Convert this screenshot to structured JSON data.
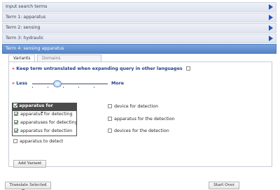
{
  "accordion": [
    {
      "label": "Input search terms",
      "active": false
    },
    {
      "label": "Term 1: apparatus",
      "active": false
    },
    {
      "label": "Term 2: sensing",
      "active": false
    },
    {
      "label": "Term 3: hydraulic",
      "active": false
    },
    {
      "label": "Term 4: sensing apparatus",
      "active": true
    }
  ],
  "tabs": {
    "variants": "Variants",
    "domains": "Domains [AUTO,DATA,HORO,MEAS]"
  },
  "keep_untranslated": {
    "label": "Keep term untranslated when expanding query in other languages",
    "checked": false
  },
  "slider": {
    "less": "Less",
    "more": "More",
    "level_fraction": 0.33
  },
  "selected_group": {
    "title": "apparatus for detecting",
    "items": [
      {
        "label": "apparatus for detecting",
        "checked": true
      },
      {
        "label": "apparatuses for detecting",
        "checked": true
      },
      {
        "label": "apparatus for detection",
        "checked": true
      }
    ]
  },
  "other_options": {
    "left": [
      {
        "label": "apparatus to detect",
        "checked": false
      }
    ],
    "right": [
      {
        "label": "device for detection",
        "checked": false
      },
      {
        "label": "apparatus for the detection",
        "checked": false
      },
      {
        "label": "devices for the detection",
        "checked": false
      }
    ]
  },
  "buttons": {
    "add_variant": "Add Variant",
    "translate": "Translate Selected Terms",
    "start_over": "Start Over"
  },
  "colors": {
    "accent": "#5584c8",
    "link": "#1e3d8a",
    "marker": "#dd2222"
  }
}
